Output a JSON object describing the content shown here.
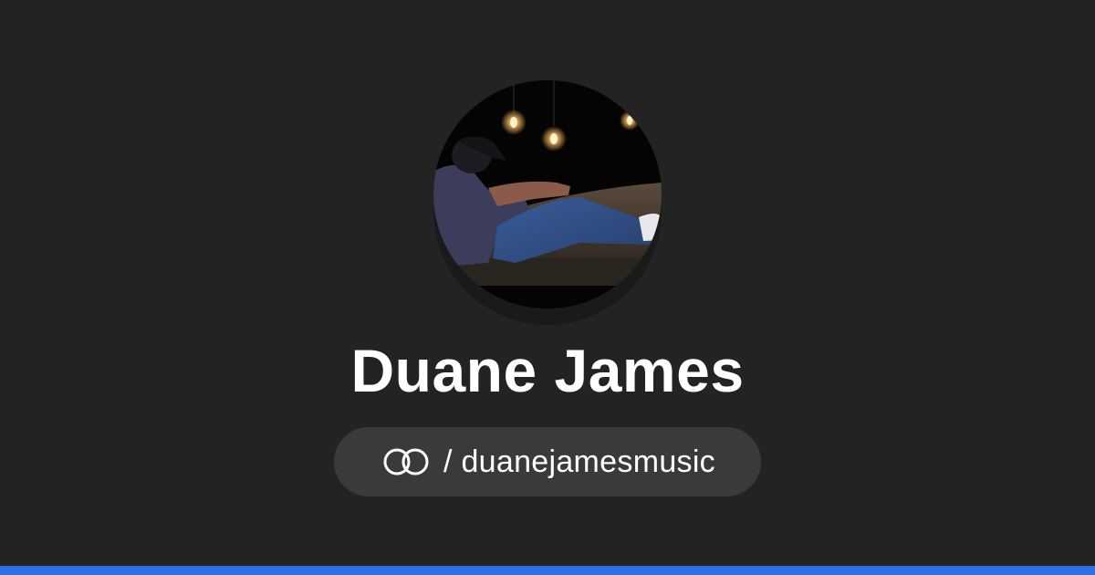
{
  "profile": {
    "name": "Duane James",
    "handle_separator": "/",
    "handle": "duanejamesmusic",
    "logo_icon": "linked-rings-icon"
  },
  "colors": {
    "background": "#232323",
    "pill_background": "#3a3a3a",
    "text": "#ffffff",
    "accent_bar": "#2f6fe8"
  }
}
